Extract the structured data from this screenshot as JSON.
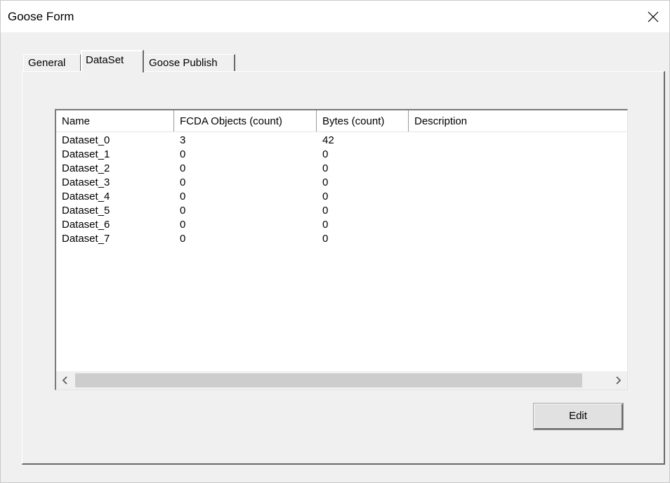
{
  "window": {
    "title": "Goose Form"
  },
  "tabs": [
    {
      "label": "General"
    },
    {
      "label": "DataSet"
    },
    {
      "label": "Goose Publish"
    }
  ],
  "active_tab": "DataSet",
  "table": {
    "columns": [
      "Name",
      "FCDA Objects (count)",
      "Bytes (count)",
      "Description"
    ],
    "rows": [
      {
        "name": "Dataset_0",
        "fcda": "3",
        "bytes": "42",
        "description": ""
      },
      {
        "name": "Dataset_1",
        "fcda": "0",
        "bytes": "0",
        "description": ""
      },
      {
        "name": "Dataset_2",
        "fcda": "0",
        "bytes": "0",
        "description": ""
      },
      {
        "name": "Dataset_3",
        "fcda": "0",
        "bytes": "0",
        "description": ""
      },
      {
        "name": "Dataset_4",
        "fcda": "0",
        "bytes": "0",
        "description": ""
      },
      {
        "name": "Dataset_5",
        "fcda": "0",
        "bytes": "0",
        "description": ""
      },
      {
        "name": "Dataset_6",
        "fcda": "0",
        "bytes": "0",
        "description": ""
      },
      {
        "name": "Dataset_7",
        "fcda": "0",
        "bytes": "0",
        "description": ""
      }
    ]
  },
  "buttons": {
    "edit_label": "Edit"
  },
  "icons": {
    "close": "close-icon",
    "scroll_left": "chevron-left-icon",
    "scroll_right": "chevron-right-icon"
  }
}
